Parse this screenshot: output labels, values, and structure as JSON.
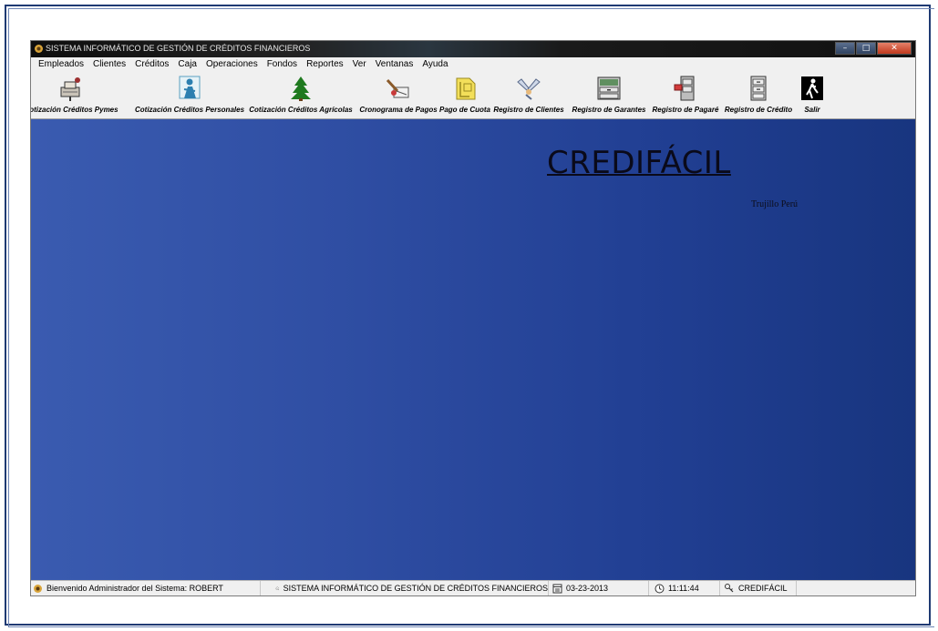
{
  "window": {
    "title": "SISTEMA INFORMÁTICO DE GESTIÓN DE CRÉDITOS FINANCIEROS",
    "minimize": "–",
    "maximize": "□",
    "close": "✕"
  },
  "menu": {
    "items": [
      "Empleados",
      "Clientes",
      "Créditos",
      "Caja",
      "Operaciones",
      "Fondos",
      "Reportes",
      "Ver",
      "Ventanas",
      "Ayuda"
    ]
  },
  "toolbar": {
    "items": [
      {
        "label": "Cotización Créditos Pymes",
        "icon": "sewing-machine-icon"
      },
      {
        "label": "Cotización Créditos Personales",
        "icon": "person-icon"
      },
      {
        "label": "Cotización Créditos Agrícolas",
        "icon": "tree-icon"
      },
      {
        "label": "Cronograma de Pagos",
        "icon": "tools-icon"
      },
      {
        "label": "Pago de Cuota",
        "icon": "folder-icon"
      },
      {
        "label": "Registro de Clientes",
        "icon": "handshake-icon"
      },
      {
        "label": "Registro de Garantes",
        "icon": "drawer-cabinet-icon"
      },
      {
        "label": "Registro de Pagaré",
        "icon": "file-cabinet-icon"
      },
      {
        "label": "Registro de Crédito",
        "icon": "cabinet-icon"
      },
      {
        "label": "Salir",
        "icon": "exit-person-icon"
      }
    ]
  },
  "main": {
    "brand_title": "CREDIFÁCIL",
    "brand_subtitle": "Trujillo Perú"
  },
  "status_bar": {
    "welcome": "Bienvenido Administrador del Sistema: ROBERT",
    "system_name": "SISTEMA INFORMÁTICO DE GESTIÓN DE CRÉDITOS FINANCIEROS",
    "date": "03-23-2013",
    "time": "11:11:44",
    "brand": "CREDIFÁCIL"
  },
  "colors": {
    "background_start": "#3a5bb0",
    "background_end": "#18357f",
    "frame": "#1f3a73"
  }
}
